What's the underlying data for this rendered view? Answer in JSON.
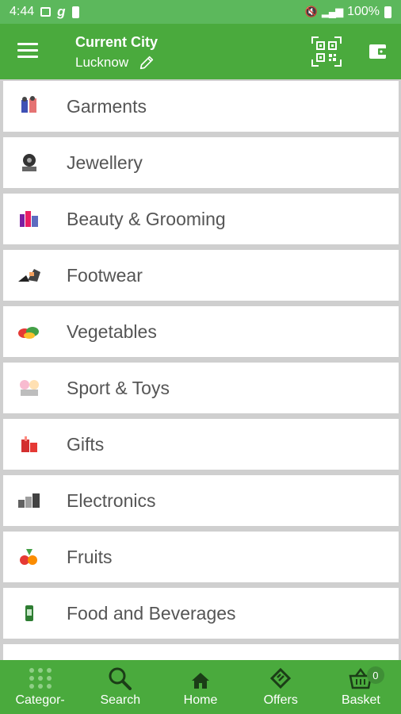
{
  "status_bar": {
    "time": "4:44",
    "carrier_glyph": "g",
    "battery": "100%"
  },
  "header": {
    "title": "Current City",
    "city": "Lucknow"
  },
  "categories": [
    {
      "label": "Garments",
      "icon": "garments-icon"
    },
    {
      "label": "Jewellery",
      "icon": "jewellery-icon"
    },
    {
      "label": "Beauty & Grooming",
      "icon": "beauty-icon"
    },
    {
      "label": "Footwear",
      "icon": "footwear-icon"
    },
    {
      "label": "Vegetables",
      "icon": "vegetables-icon"
    },
    {
      "label": "Sport & Toys",
      "icon": "toys-icon"
    },
    {
      "label": "Gifts",
      "icon": "gifts-icon"
    },
    {
      "label": "Electronics",
      "icon": "electronics-icon"
    },
    {
      "label": "Fruits",
      "icon": "fruits-icon"
    },
    {
      "label": "Food and Beverages",
      "icon": "food-icon"
    }
  ],
  "bottom_nav": {
    "categories": "Categor-",
    "search": "Search",
    "home": "Home",
    "offers": "Offers",
    "basket": "Basket",
    "basket_count": "0"
  },
  "colors": {
    "status_bar": "#5cb85c",
    "app_bar": "#4aaa3d",
    "list_bg": "#cfcfcf",
    "label_text": "#555555"
  }
}
